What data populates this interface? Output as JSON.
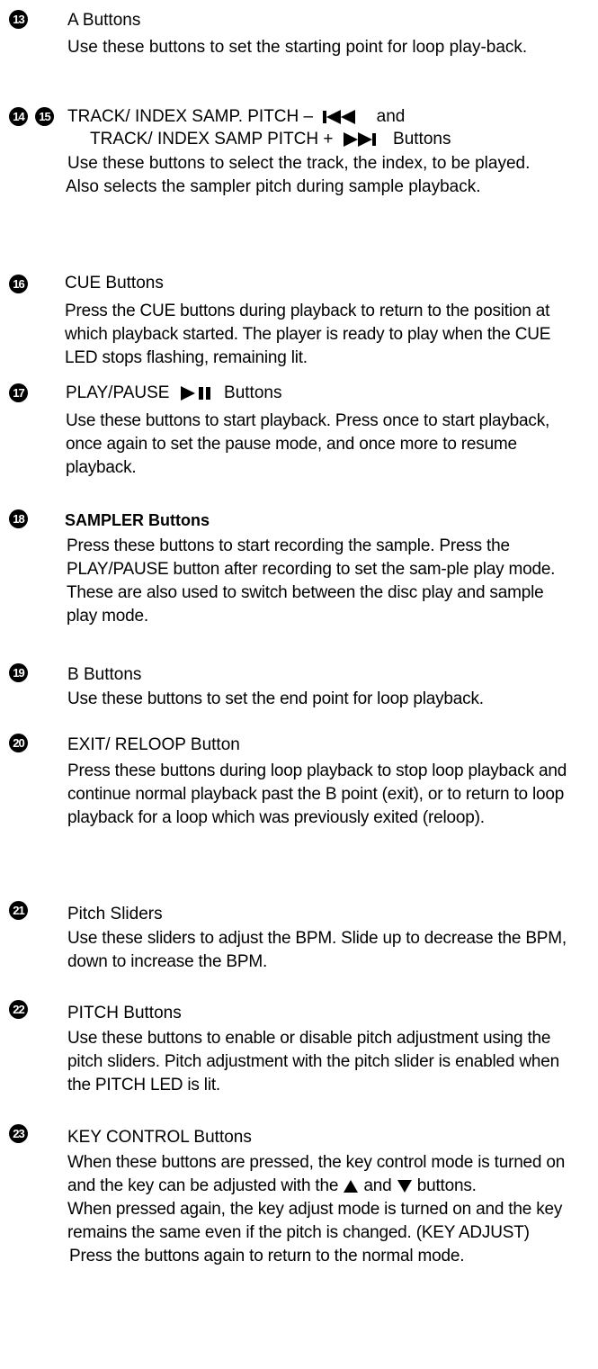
{
  "entries": [
    {
      "num": "13",
      "title": "A Buttons",
      "paragraphs": [
        "Use these buttons to set the starting point for loop play-back."
      ]
    },
    {
      "num": "14",
      "num2": "15",
      "title_line1": "TRACK/ INDEX SAMP. PITCH  –",
      "title_line1_end": "and",
      "title_line2": "TRACK/ INDEX SAMP PITCH  +",
      "title_line2_end": "Buttons",
      "paragraphs": [
        "Use these buttons to select the track, the index, to be played.",
        "Also selects the sampler pitch during sample playback."
      ]
    },
    {
      "num": "16",
      "title": "CUE Buttons",
      "paragraphs": [
        "Press the CUE buttons during playback to return to the position at which playback started. The player is ready to play when the CUE LED stops flashing, remaining lit."
      ]
    },
    {
      "num": "17",
      "title": "PLAY/PAUSE",
      "title_end": "Buttons",
      "paragraphs": [
        "Use these buttons to start playback. Press once to start playback, once again to set the pause mode, and once more to resume playback."
      ]
    },
    {
      "num": "18",
      "title": "SAMPLER Buttons",
      "paragraphs": [
        "Press these buttons to start recording the sample. Press the PLAY/PAUSE button after recording to set the sam-ple play mode. These are also used to switch between the disc play and sample play mode."
      ]
    },
    {
      "num": "19",
      "title": "B Buttons",
      "paragraphs": [
        "Use these buttons to set the end point for loop playback."
      ]
    },
    {
      "num": "20",
      "title": "EXIT/ RELOOP Button",
      "paragraphs": [
        "Press these buttons during loop playback to stop loop playback and continue normal playback past the B point (exit), or to return to loop playback for a loop which was previously exited (reloop)."
      ]
    },
    {
      "num": "21",
      "title": "Pitch Sliders",
      "paragraphs": [
        "Use these sliders to adjust the BPM. Slide up to decrease the BPM, down to increase the BPM."
      ]
    },
    {
      "num": "22",
      "title": "PITCH Buttons",
      "paragraphs": [
        "Use these buttons to enable or disable pitch adjustment using the pitch sliders. Pitch adjustment with the pitch slider is enabled when the PITCH LED is lit."
      ]
    },
    {
      "num": "23",
      "title": "KEY CONTROL Buttons",
      "p1_before": "When these buttons are pressed, the key control mode is turned on and the key can be adjusted with the",
      "p1_mid": "and",
      "p1_after": "buttons.",
      "p2": "When pressed again, the key adjust mode is turned on and the key remains the same even if the pitch is changed. (KEY ADJUST)",
      "p3": "Press the buttons again to return to the normal mode."
    }
  ]
}
